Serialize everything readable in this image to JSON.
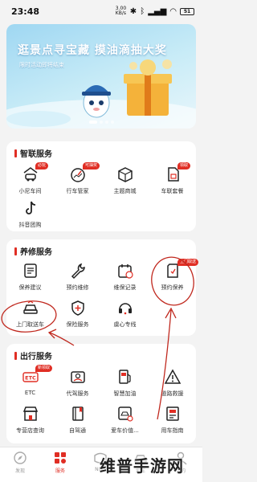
{
  "status_bar": {
    "time": "23:48",
    "net_speed": "3.00 KB/s",
    "battery": "51"
  },
  "banner": {
    "title": "逛景点寻宝藏 摸油滴抽大奖",
    "subtitle": "限时活动即将结束"
  },
  "sections": {
    "smart": {
      "title": "智联服务",
      "items": [
        {
          "label": "小尼车间",
          "icon": "car-garage-icon",
          "badge": "必玩"
        },
        {
          "label": "行车管家",
          "icon": "speedometer-icon",
          "badge": "可抽奖"
        },
        {
          "label": "主题商城",
          "icon": "box-icon",
          "badge": ""
        },
        {
          "label": "车联套餐",
          "icon": "sim-card-icon",
          "badge": "领取"
        },
        {
          "label": "抖音团购",
          "icon": "tiktok-icon",
          "badge": ""
        }
      ]
    },
    "maintenance": {
      "title": "养修服务",
      "items": [
        {
          "label": "保养建议",
          "icon": "maintenance-list-icon",
          "badge": ""
        },
        {
          "label": "预约维修",
          "icon": "wrench-icon",
          "badge": ""
        },
        {
          "label": "维保记录",
          "icon": "calendar-clock-icon",
          "badge": ""
        },
        {
          "label": "预约保养",
          "icon": "reservation-card-icon",
          "badge": "上门取送"
        },
        {
          "label": "上门取送车",
          "icon": "pickup-car-icon",
          "badge": ""
        },
        {
          "label": "保险服务",
          "icon": "shield-plus-icon",
          "badge": ""
        },
        {
          "label": "虞心专线",
          "icon": "headset-icon",
          "badge": ""
        }
      ]
    },
    "travel": {
      "title": "出行服务",
      "items": [
        {
          "label": "ETC",
          "icon": "etc-icon",
          "badge": "新领取"
        },
        {
          "label": "代驾服务",
          "icon": "chauffeur-icon",
          "badge": ""
        },
        {
          "label": "智慧加油",
          "icon": "fuel-pump-icon",
          "badge": ""
        },
        {
          "label": "道路救援",
          "icon": "warning-triangle-icon",
          "badge": ""
        },
        {
          "label": "专营店查询",
          "icon": "store-icon",
          "badge": ""
        },
        {
          "label": "自驾通",
          "icon": "notebook-icon",
          "badge": ""
        },
        {
          "label": "爱车价值...",
          "icon": "car-value-icon",
          "badge": ""
        },
        {
          "label": "用车指南",
          "icon": "guide-book-icon",
          "badge": ""
        }
      ]
    }
  },
  "tabs": [
    {
      "label": "发现",
      "icon": "discover-icon"
    },
    {
      "label": "服务",
      "icon": "service-icon"
    },
    {
      "label": "NISS",
      "icon": "niss-icon"
    },
    {
      "label": "爱车",
      "icon": "car-tab-icon"
    },
    {
      "label": "我的",
      "icon": "profile-icon"
    }
  ],
  "watermark": "维普手游网",
  "colors": {
    "accent": "#e02e24",
    "annotation": "#c0281e"
  }
}
